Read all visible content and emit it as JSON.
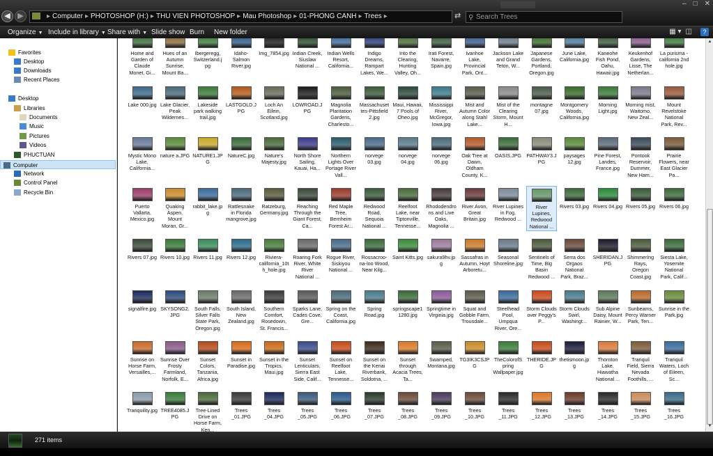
{
  "address": {
    "crumbs": [
      "Computer",
      "PHOTOSHOP (H:)",
      "THU VIEN PHOTOSHOP",
      "Mau Photoshop",
      "01-PHONG CANH",
      "Trees"
    ],
    "search_placeholder": "Search Trees"
  },
  "toolbar": {
    "items": [
      "Organize",
      "Include in library",
      "Share with",
      "Slide show",
      "Burn",
      "New folder"
    ]
  },
  "nav": {
    "items": [
      "Favorites",
      "Desktop",
      "Downloads",
      "Recent Places",
      "Desktop",
      "Libraries",
      "Documents",
      "Music",
      "Pictures",
      "Videos",
      "PHUCTUAN",
      "Computer",
      "Network",
      "Control Panel",
      "Recycle Bin"
    ]
  },
  "files": [
    [
      "Home and Garden of Claude Monet, Gi...",
      "Hues of an Autumn Sunrise, Mount Ba...",
      "Ibergeregg, Switzerland.jpg",
      "Idaho-Salmon River.jpg",
      "Img_7854.jpg",
      "Indian Creek, Siuslaw National ...",
      "Indian Wells Resort, California...",
      "Indigo Dreams, Rampart Lakes, We...",
      "Into the Clearing, Hunting Valley, Oh...",
      "Irati Forest, Navarre, Spain.jpg",
      "Ivanhoe Lake, Provincial Park, Ont...",
      "Jackson Lake and Grand Teton, W...",
      "Japanese Gardens, Portland, Oregon.jpg",
      "June Lake, California.jpg",
      "Kaneohe Fish Pond, Oahu, Hawaii.jpg",
      "Keukenhof Gardens, Lisse, The Netherlan...",
      "La purisma - california 2nd hole.jpg"
    ],
    [
      "Lake 000.jpg",
      "Lake Glacier, Peak Wildernes...",
      "Lakeside park walking trail.jpg",
      "LASTGOLD.JPG",
      "Loch An Eilein, Scotland.jpg",
      "LOWROAD.JPG",
      "Magnolia Plantation Gardens, Charlesto...",
      "Massachusettes-Pittsfield 2.jpg",
      "Maui, Hawaii, 7 Pools of Oheo.jpg",
      "Mississippi River, McGregor, Iowa.jpg",
      "Mist and Autumn Color along Stahl Lake...",
      "Mist of the Clearing Storm, Mount H...",
      "montagne 07.jpg",
      "Montgomery Woods, California.jpg",
      "Morning Light.jpg",
      "Morning mist, Waitomo, New Zeal...",
      "Mount Revelstoke National Park, Rev..."
    ],
    [
      "Mystic Mono Lake, California...",
      "nature a.JPG",
      "NATURE1.JPG",
      "NatureC.jpg",
      "Nature's Majesty.jpg",
      "North Shore Sailing, Kauai, Ha...",
      "Northern Lights Over Portage River Vall...",
      "norvege 03.jpg",
      "norvege 04.jpg",
      "norvege 06.jpg",
      "Oak Tree at Dawn, Oldham County, K...",
      "OASIS.JPG",
      "PATHWAY3.JPG",
      "paysages 12.jpg",
      "Pine Forest, Landes, France.jpg",
      "Pontook Reservoir, Dummer, New Ham...",
      "Prairie Flowers, near East Glacier Pa..."
    ],
    [
      "Puerto Vallarta, Mexico.jpg",
      "Quaking Aspen, Mount Moran, Gr...",
      "rabbit_lake.jpg",
      "Rattlesnake in Florida mangrove.jpg",
      "Ratzeburg, Germany.jpg",
      "Reaching Through the Giant Forest, Ca...",
      "Red Maple Tree, Bernheim Forest Ar...",
      "Redwood Road, Sequoia National ...",
      "Reelfoot Lake, near Tiptonville, Tennesse...",
      "Rhododendrons and Live Oaks, Magnolia ...",
      "River Avon, Great Britain.jpg",
      "River Lupines in Fog, Redwood ...",
      "River Lupines, Redwood National ...",
      "Rivers 03.jpg",
      "Rivers 04.jpg",
      "Rivers 05.jpg",
      "Rivers 06.jpg"
    ],
    [
      "Rivers 07.jpg",
      "Rivers 10.jpg",
      "Rivers 11.jpg",
      "Rivers 12.jpg",
      "Riviera-california_10th_hole.jpg",
      "Roaring Fork River, White River National ...",
      "Rogue River, Siskiyou National ...",
      "Rossacroo-na-loo Wood, Near Kilg...",
      "Saint Kitts.jpg",
      "sakura9hv.jpg",
      "Sassafras in Autumn, Hoyt Arboretu...",
      "Seasonal Shoreline.jpg",
      "Sentinels of Time, Big Basin Redwood ...",
      "Serra dos Orgaos National Park, Braz...",
      "SHERIDAN.JPG",
      "Shimmering Rays, Oregon Coast.jpg",
      "Siesta Lake, Yosemite National Park, Calif..."
    ],
    [
      "signalfire.jpg",
      "SKYSONG2.JPG",
      "South Falls, Silver Falls State Park, Oregon.jpg",
      "South Island, New Zealand.jpg",
      "Southern Comfort, Rosedown, St. Francis...",
      "Sparks Lane, Cades Cove, Gre...",
      "Spring on the Coast, California.jpg",
      "Spring Road.jpg",
      "springscape11280.jpg",
      "Springtime in Virginia.jpg",
      "Squat and Gobble Farm, Trousdale...",
      "Steelhead Pool, Umpqua River, Ore...",
      "Storm Clouds over Peggy's P...",
      "Storm Clouds Swirl, Washingt...",
      "Sub Alpine Daisy, Mount Rainier, W...",
      "Sunbeams, Percy Warner Park, Ten...",
      "Sunrise in the Park.jpg"
    ],
    [
      "Sunrise on Horse Farm, Versailles,...",
      "Sunrise Over Frosty Farmland, Norfolk, E...",
      "Sunset Colors, Tanzania, Africa.jpg",
      "Sunset in Paradise.jpg",
      "Sunset in the Tropics, Maui.jpg",
      "Sunset Lenticulars, Sierra East Side, Calif...",
      "Sunset on Reelfoot Lake, Tennesse...",
      "Sunset on the Kenai Riverbank, Soldotna, ...",
      "Sunset through Acacia Trees, Ta...",
      "Swamped, Montana.jpg",
      "TG3IK3CSJPG",
      "TheColorofSpring Wallpaper.jpg",
      "THERIDE.JPG",
      "thetismoon.jpg",
      "Thornton Lake, Hiawatha National ...",
      "Tranquil Field, Sierra Nevada Foothills, ...",
      "Tranquil Waters, Loch of Eileen, Sc..."
    ],
    [
      "Tranquility.jpg",
      "TREE4085.JPG",
      "Tree-Lined Drive on Horse Farm, Ken...",
      "Trees _01.JPG",
      "Trees _04.JPG",
      "Trees _05.JPG",
      "Trees _06.JPG",
      "Trees _07.JPG",
      "Trees _08.JPG",
      "Trees _09.JPG",
      "Trees _10.JPG",
      "Trees _11.JPG",
      "Trees _12.JPG",
      "Trees _13.JPG",
      "Trees _14.JPG",
      "Trees _15.JPG",
      "Trees _16.JPG"
    ]
  ],
  "thumb_colors": [
    [
      "#3b6b3a",
      "#8a6a3a",
      "#3a7a3a",
      "#2e5a8a",
      "#1a1a1a",
      "#2a4a2a",
      "#3a6a9a",
      "#2a3a7a",
      "#4a6a3a",
      "#3a5a3a",
      "#3a5a8a",
      "#6a7a8a",
      "#3a6a2a",
      "#4a7a9a",
      "#3a5a3a",
      "#8a5a8a",
      "#3a7a3a"
    ],
    [
      "#3a6a8a",
      "#4a6a7a",
      "#3a7a3a",
      "#b45a1a",
      "#6a6a5a",
      "#1a1a1a",
      "#4a5a3a",
      "#3a5a3a",
      "#2a4a3a",
      "#3a7a8a",
      "#5a5a4a",
      "#8a8a8a",
      "#4a5a4a",
      "#3a6a2a",
      "#3a7a3a",
      "#7a7a8a",
      "#9a5a3a"
    ],
    [
      "#6a7a9a",
      "#5a8a3a",
      "#c8a82a",
      "#3a6a3a",
      "#4a6a3a",
      "#3a3a8a",
      "#2a5a6a",
      "#4a6a8a",
      "#5a7a8a",
      "#4a6a7a",
      "#b45a2a",
      "#3a6a3a",
      "#8a8a7a",
      "#5a8a3a",
      "#5a6a7a",
      "#3a4a5a",
      "#7a5a3a"
    ],
    [
      "#9a3a6a",
      "#c88a2a",
      "#3a6a9a",
      "#4a6a7a",
      "#5a5a3a",
      "#3a4a3a",
      "#9a3a2a",
      "#3a5a3a",
      "#4a6a3a",
      "#4a3a3a",
      "#6a3a3a",
      "#7a8a9a",
      "#6a9a6a",
      "#3a6a3a",
      "#2a8a3a",
      "#3a5a3a",
      "#3a6a3a"
    ],
    [
      "#3a4a3a",
      "#3a7a3a",
      "#3a8a5a",
      "#2a6a8a",
      "#4a7a3a",
      "#6a6a6a",
      "#4a6a8a",
      "#3a6a3a",
      "#3a8a3a",
      "#9a7a9a",
      "#c87a2a",
      "#6a7a8a",
      "#4a5a3a",
      "#6a4a3a",
      "#1a1a2a",
      "#4a5a3a",
      "#3a6a3a"
    ],
    [
      "#1a2a5a",
      "#2a4a7a",
      "#6a7a6a",
      "#6a6a6a",
      "#3a3a3a",
      "#5a5a5a",
      "#4a6a7a",
      "#4a7a8a",
      "#3a6a3a",
      "#8a5a9a",
      "#5a5a4a",
      "#3a6a9a",
      "#c84a1a",
      "#4a7a8a",
      "#5a7a5a",
      "#b86a2a",
      "#6a8a3a"
    ],
    [
      "#c86a2a",
      "#8a5a8a",
      "#b44a1a",
      "#d86a1a",
      "#c86a1a",
      "#3a4a8a",
      "#c84a1a",
      "#3a2a1a",
      "#d87a2a",
      "#5a5a4a",
      "#c88a2a",
      "#3a7a3a",
      "#c84a1a",
      "#1a1a3a",
      "#d87a3a",
      "#7a5a3a",
      "#3a6a9a"
    ],
    [
      "#8a9aaa",
      "#3a7a3a",
      "#4a6a3a",
      "#3a3a3a",
      "#1a2a5a",
      "#3a5a7a",
      "#2a5a8a",
      "#2a3a2a",
      "#6a4a3a",
      "#4a3a5a",
      "#6a4a3a",
      "#2a2a2a",
      "#d8782a",
      "#6a3a2a",
      "#2a2a2a",
      "#c88a5a",
      "#3a6a8a"
    ]
  ],
  "status": {
    "count": "271 items"
  }
}
